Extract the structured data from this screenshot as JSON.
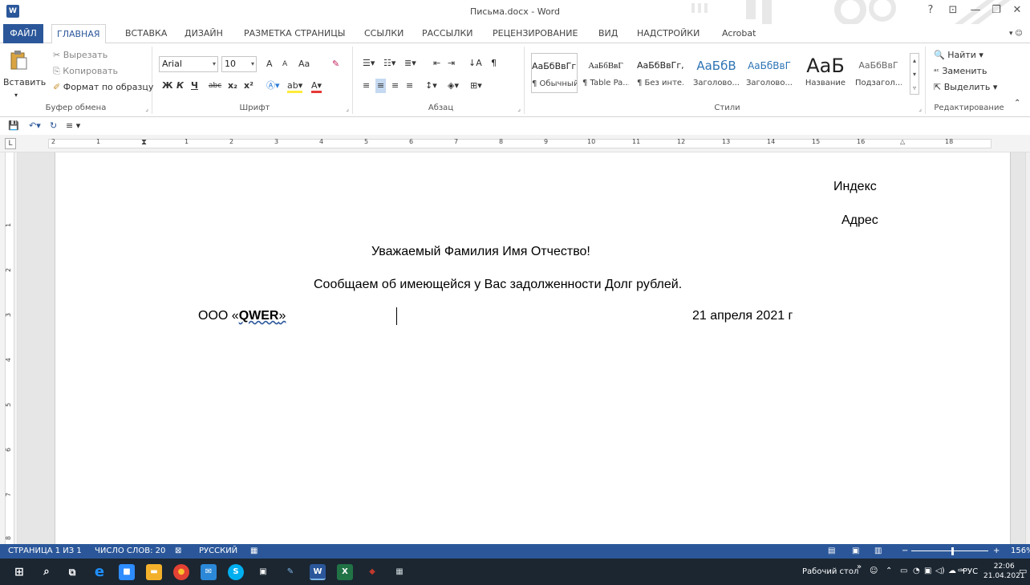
{
  "window": {
    "title": "Письма.docx - Word",
    "help": "?",
    "minimize": "—",
    "restore": "❐",
    "close": "✕"
  },
  "tabs": {
    "file": "ФАЙЛ",
    "items": [
      "ГЛАВНАЯ",
      "ВСТАВКА",
      "ДИЗАЙН",
      "РАЗМЕТКА СТРАНИЦЫ",
      "ССЫЛКИ",
      "РАССЫЛКИ",
      "РЕЦЕНЗИРОВАНИЕ",
      "ВИД",
      "НАДСТРОЙКИ",
      "Acrobat"
    ],
    "active": "ГЛАВНАЯ"
  },
  "clipboard": {
    "paste": "Вставить",
    "cut": "Вырезать",
    "copy": "Копировать",
    "format_painter": "Формат по образцу",
    "label": "Буфер обмена"
  },
  "font": {
    "name": "Arial",
    "size": "10",
    "label": "Шрифт",
    "grow": "A",
    "shrink": "A",
    "case": "Aa",
    "bold": "Ж",
    "italic": "К",
    "underline": "Ч",
    "strike": "abc",
    "sub": "x₂",
    "sup": "x²"
  },
  "paragraph": {
    "label": "Абзац",
    "pilcrow": "¶"
  },
  "styles": {
    "label": "Стили",
    "items": [
      {
        "sample": "АаБбВвГг,",
        "name": "¶ Обычный"
      },
      {
        "sample": "АаБбВвГ",
        "name": "¶ Table Pa..."
      },
      {
        "sample": "АаБбВвГг,",
        "name": "¶ Без инте..."
      },
      {
        "sample": "АаБбВ",
        "name": "Заголово..."
      },
      {
        "sample": "АаБбВвГ",
        "name": "Заголово..."
      },
      {
        "sample": "АаБ",
        "name": "Название"
      },
      {
        "sample": "АаБбВвГ",
        "name": "Подзагол..."
      }
    ]
  },
  "editing": {
    "find": "Найти",
    "replace": "Заменить",
    "select": "Выделить",
    "label": "Редактирование"
  },
  "ruler": {
    "numbers": [
      "2",
      "1",
      "1",
      "2",
      "3",
      "4",
      "5",
      "6",
      "7",
      "8",
      "9",
      "10",
      "11",
      "12",
      "13",
      "14",
      "15",
      "16",
      "18"
    ],
    "vnumbers": [
      "1",
      "2",
      "3",
      "4",
      "5",
      "6",
      "7",
      "8"
    ]
  },
  "document": {
    "index": "Индекс",
    "address": "Адрес",
    "greeting": "Уважаемый Фамилия Имя Отчество!",
    "body": "Сообщаем об имеющейся у Вас задолженности Долг рублей.",
    "org_prefix": "ООО «",
    "org_name": "QWER",
    "org_suffix": "»",
    "date": "21 апреля 2021 г"
  },
  "status": {
    "page": "СТРАНИЦА 1 ИЗ 1",
    "words": "ЧИСЛО СЛОВ: 20",
    "language": "РУССКИЙ",
    "zoom": "156%"
  },
  "taskbar": {
    "desktop": "Рабочий стол",
    "chevron": "»",
    "lang": "РУС",
    "time": "22:06",
    "date": "21.04.2021",
    "apps": [
      {
        "name": "edge",
        "label": "e",
        "color": "#1e90ff"
      },
      {
        "name": "zoom",
        "label": "■",
        "color": "#2d8cff"
      },
      {
        "name": "explorer",
        "label": "▬",
        "color": "#f3b12b"
      },
      {
        "name": "chrome",
        "label": "●",
        "color": "#e34133"
      },
      {
        "name": "mail",
        "label": "✉",
        "color": "#2b88d8"
      },
      {
        "name": "skype",
        "label": "S",
        "color": "#00aff0"
      },
      {
        "name": "store",
        "label": "▣",
        "color": "#ffffff"
      },
      {
        "name": "pen",
        "label": "✎",
        "color": "#7fb6e8"
      },
      {
        "name": "word",
        "label": "W",
        "color": "#2b579a"
      },
      {
        "name": "excel",
        "label": "X",
        "color": "#217346"
      },
      {
        "name": "app-red",
        "label": "◆",
        "color": "#c0392b"
      },
      {
        "name": "calendar",
        "label": "▦",
        "color": "#cfd8dc"
      }
    ]
  }
}
